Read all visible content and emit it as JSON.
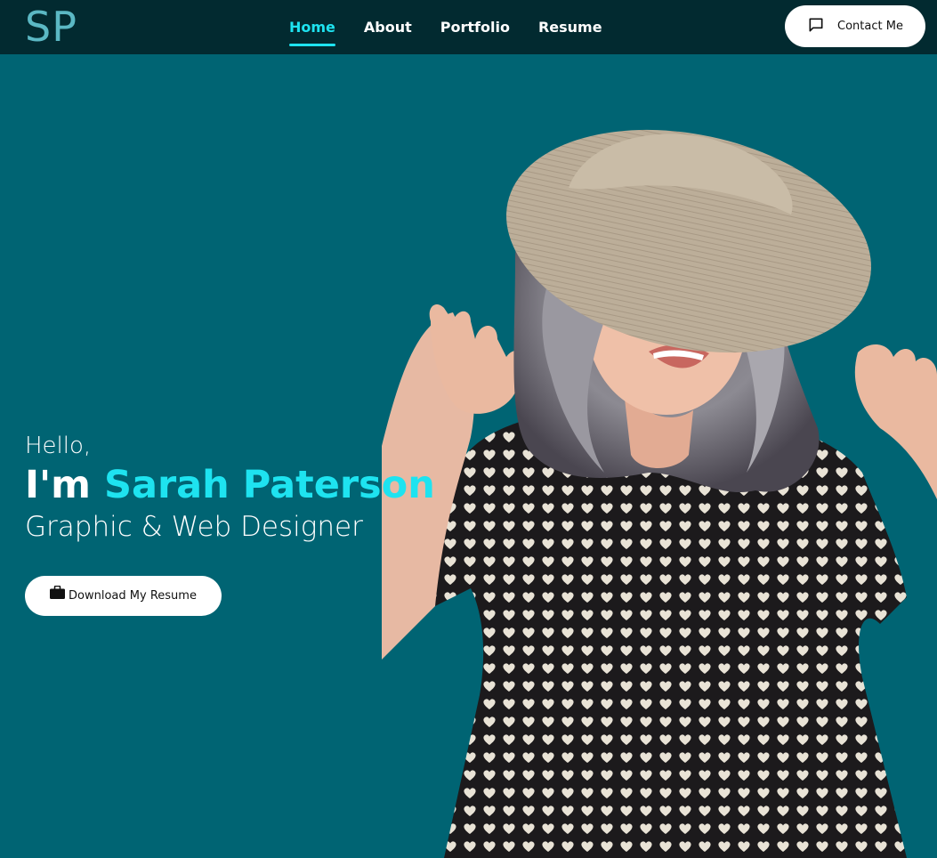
{
  "logo": {
    "text": "SP"
  },
  "nav": {
    "links": [
      {
        "label": "Home",
        "active": true
      },
      {
        "label": "About",
        "active": false
      },
      {
        "label": "Portfolio",
        "active": false
      },
      {
        "label": "Resume",
        "active": false
      }
    ],
    "contact_label": "Contact Me",
    "contact_icon": "chat-bubble-icon"
  },
  "hero": {
    "greeting": "Hello,",
    "intro": "I'm",
    "name": "Sarah Paterson",
    "role": "Graphic & Web Designer",
    "resume_button_label": "Download My Resume",
    "resume_button_icon": "briefcase-icon"
  },
  "colors": {
    "background": "#006473",
    "navbar": "#022a30",
    "accent": "#1ee3f0",
    "logo": "#5bb8c4",
    "button_bg": "#ffffff"
  }
}
